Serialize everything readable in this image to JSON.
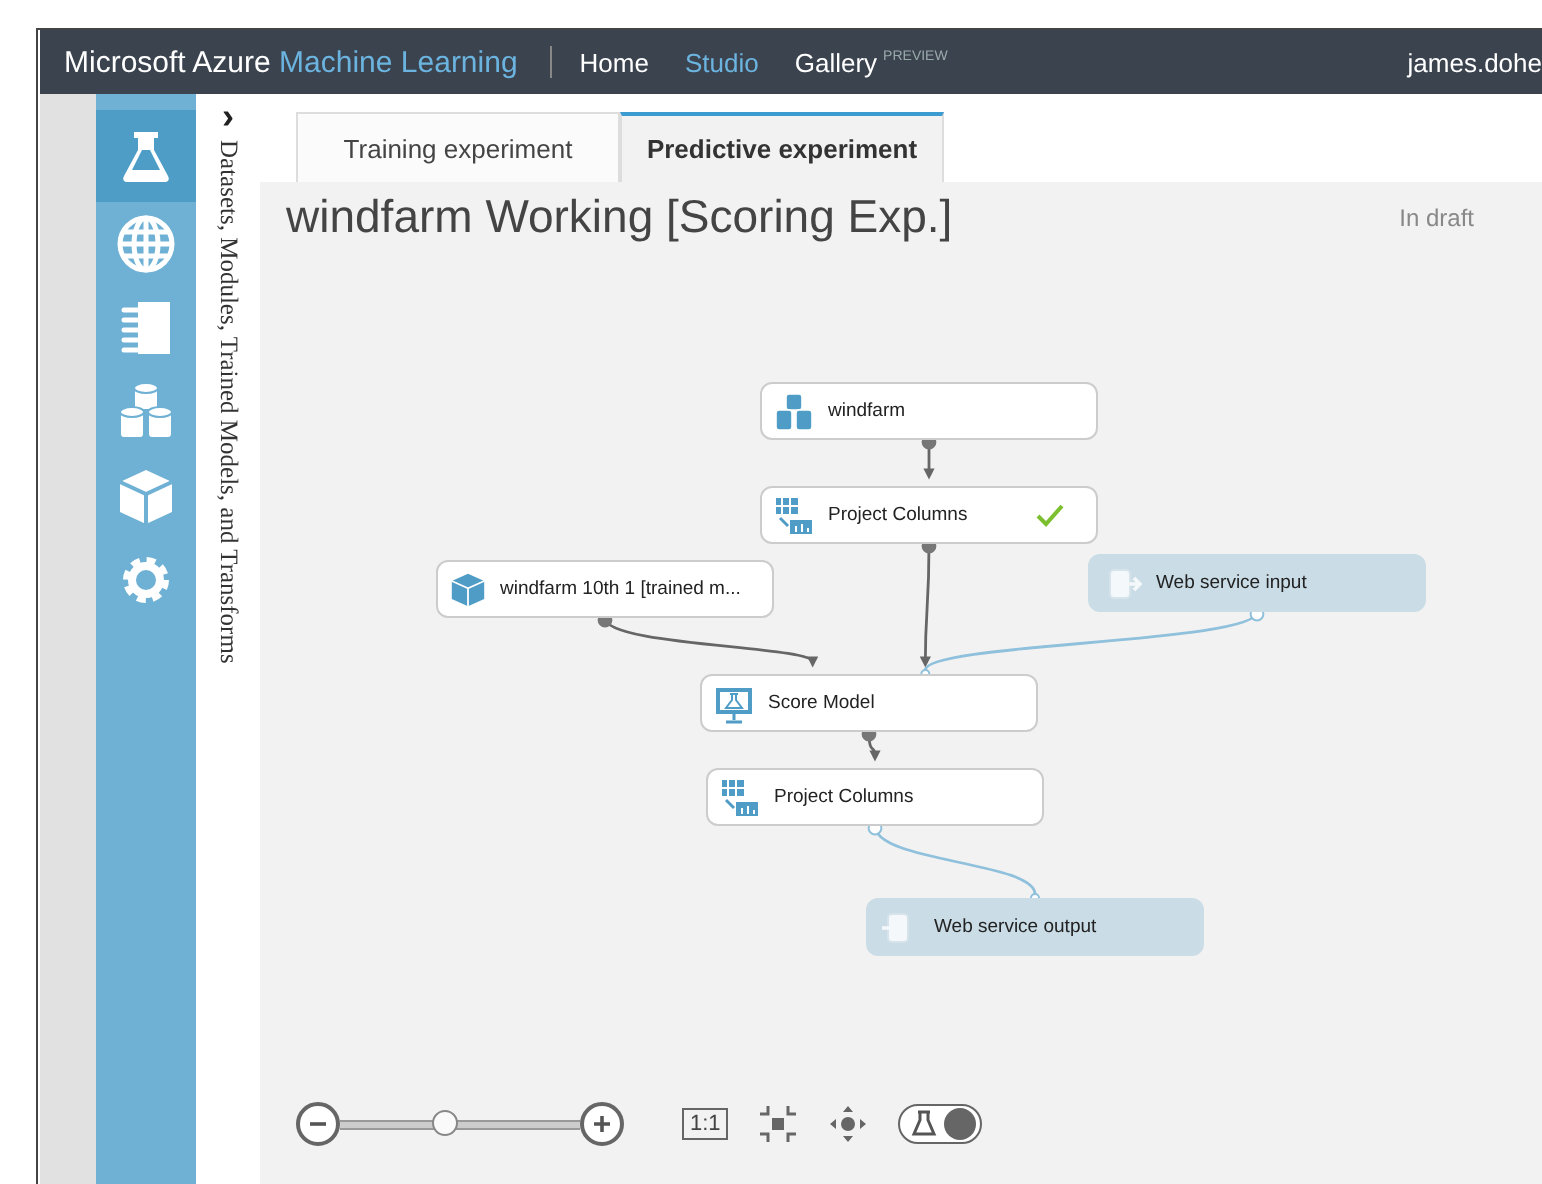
{
  "header": {
    "brand": "Microsoft Azure",
    "product": "Machine Learning",
    "nav": [
      {
        "label": "Home",
        "selected": false
      },
      {
        "label": "Studio",
        "selected": true
      },
      {
        "label": "Gallery",
        "badge": "PREVIEW",
        "selected": false
      }
    ],
    "user": "james.dohe"
  },
  "sidebar": {
    "items": [
      {
        "kind": "experiments",
        "selected": true
      },
      {
        "kind": "web-services",
        "selected": false
      },
      {
        "kind": "notebooks",
        "selected": false
      },
      {
        "kind": "datasets",
        "selected": false
      },
      {
        "kind": "trained-models",
        "selected": false
      },
      {
        "kind": "settings",
        "selected": false
      }
    ]
  },
  "palette": {
    "toggle": "›",
    "title": "Datasets, Modules, Trained Models, and Transforms"
  },
  "tabs": [
    {
      "label": "Training experiment",
      "selected": false
    },
    {
      "label": "Predictive experiment",
      "selected": true
    }
  ],
  "experiment": {
    "title": "windfarm Working [Scoring Exp.]",
    "status": "In draft"
  },
  "nodes": [
    {
      "kind": "dataset",
      "label": "windfarm",
      "complete": false
    },
    {
      "kind": "module",
      "label": "Project Columns",
      "complete": true
    },
    {
      "kind": "trained",
      "label": "windfarm 10th 1 [trained m...",
      "complete": false
    },
    {
      "kind": "input",
      "label": "Web service input",
      "complete": false
    },
    {
      "kind": "score",
      "label": "Score Model",
      "complete": false
    },
    {
      "kind": "module",
      "label": "Project Columns",
      "complete": false
    },
    {
      "kind": "output",
      "label": "Web service output",
      "complete": false
    }
  ],
  "toolbar": {
    "zoom": {
      "level": 0.44
    },
    "actual_size": "1:1",
    "view_toggle": {
      "on": true
    }
  }
}
